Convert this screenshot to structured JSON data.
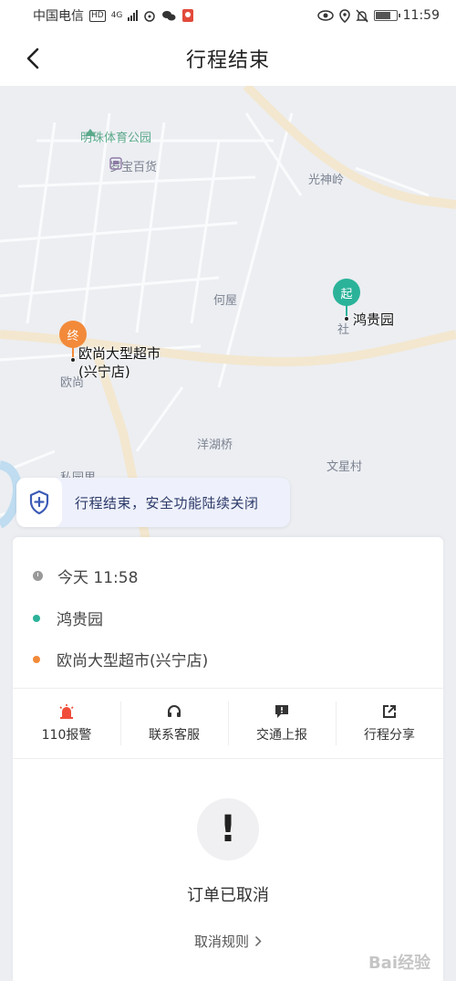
{
  "status_bar": {
    "carrier": "中国电信",
    "hd": "HD",
    "network": "4G",
    "time": "11:59",
    "battery_fraction": 0.8
  },
  "nav": {
    "title": "行程结束",
    "back_icon": "chevron-left-icon"
  },
  "map": {
    "labels": {
      "park": "明珠体育公园",
      "store": "岁宝百货",
      "guangshenling": "光神岭",
      "hewu": "何屋",
      "she": "社",
      "ouchang": "欧尚",
      "yanghuqiao": "洋湖桥",
      "wenxingcun": "文星村",
      "keyuan": "私园里"
    },
    "start": {
      "badge": "起",
      "name": "鸿贵园",
      "color": "#2bb39a"
    },
    "end": {
      "badge": "终",
      "name_line1": "欧尚大型超市",
      "name_line2": "(兴宁店)",
      "color": "#f28a3a"
    }
  },
  "banner": {
    "text": "行程结束，安全功能陆续关闭",
    "icon": "shield-plus-icon"
  },
  "trip": {
    "time": "今天 11:58",
    "start": "鸿贵园",
    "end": "欧尚大型超市(兴宁店)",
    "start_color": "#2bb39a",
    "end_color": "#f28a3a"
  },
  "actions": [
    {
      "label": "110报警",
      "icon": "alarm-siren-icon",
      "color": "#f04d3a"
    },
    {
      "label": "联系客服",
      "icon": "headset-icon",
      "color": "#333333"
    },
    {
      "label": "交通上报",
      "icon": "report-flag-icon",
      "color": "#333333"
    },
    {
      "label": "行程分享",
      "icon": "share-icon",
      "color": "#333333"
    }
  ],
  "order": {
    "status_icon": "exclamation-icon",
    "status": "订单已取消",
    "rules_label": "取消规则",
    "rules_chevron": "chevron-right-icon"
  },
  "watermark": "Bai经验"
}
